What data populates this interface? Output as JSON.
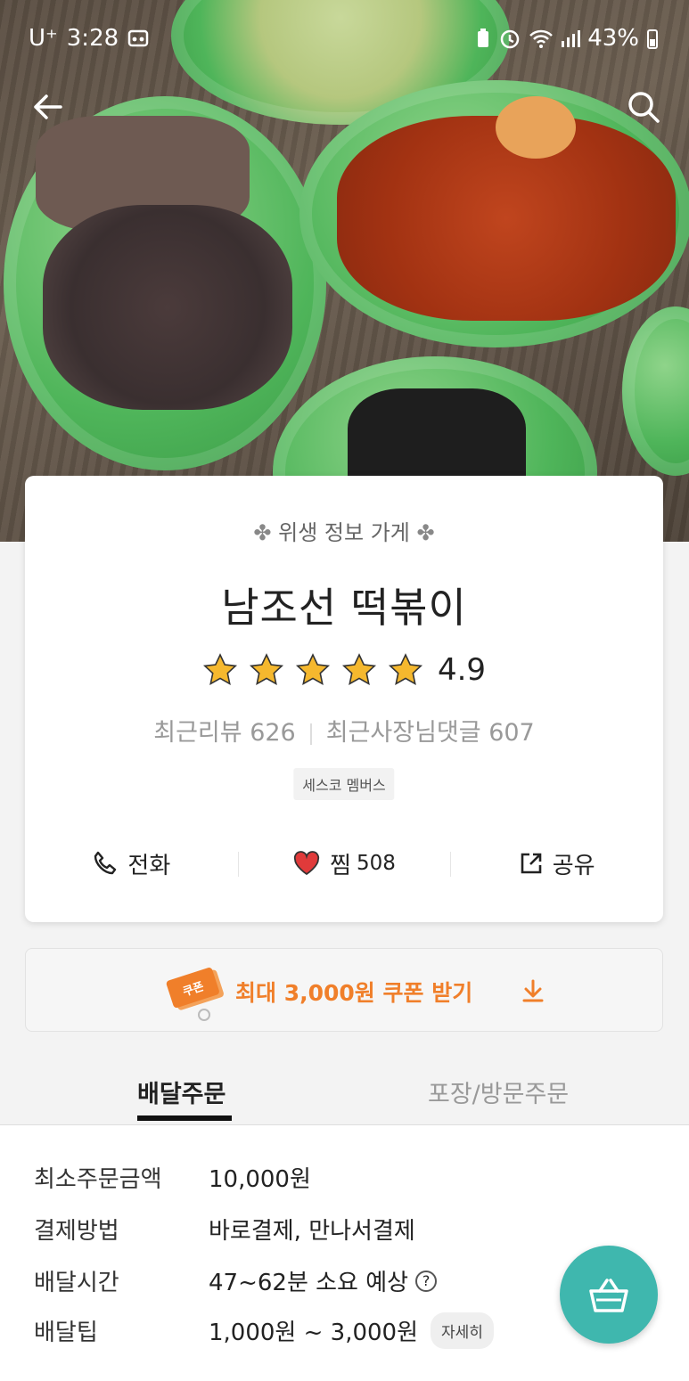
{
  "status_bar": {
    "carrier": "U⁺",
    "time": "3:28",
    "battery": "43%"
  },
  "store": {
    "hygiene_label": "위생 정보 가게",
    "name": "남조선 떡볶이",
    "rating": "4.9",
    "rating_stars": 5,
    "recent_reviews": "최근리뷰 626",
    "recent_owner_comments": "최근사장님댓글 607",
    "badge": "세스코 멤버스"
  },
  "actions": {
    "call_label": "전화",
    "like_label": "찜",
    "like_count": "508",
    "share_label": "공유"
  },
  "coupon": {
    "icon_text": "쿠폰",
    "label": "최대 3,000원 쿠폰 받기"
  },
  "tabs": [
    {
      "label": "배달주문",
      "active": true
    },
    {
      "label": "포장/방문주문",
      "active": false
    }
  ],
  "info": {
    "min_order_label": "최소주문금액",
    "min_order_value": "10,000원",
    "payment_label": "결제방법",
    "payment_value": "바로결제, 만나서결제",
    "delivery_time_label": "배달시간",
    "delivery_time_value": "47~62분 소요 예상",
    "delivery_tip_label": "배달팁",
    "delivery_tip_value": "1,000원 ~ 3,000원",
    "detail_button": "자세히"
  },
  "colors": {
    "accent_orange": "#f07f2a",
    "cart_teal": "#3fb7ae",
    "star": "#f5b82e",
    "heart": "#e03a3a"
  },
  "icons": [
    "back-arrow-icon",
    "search-icon",
    "phone-icon",
    "heart-icon",
    "share-icon",
    "download-arrow-icon",
    "coupon-ticket-icon",
    "question-icon",
    "basket-icon"
  ]
}
